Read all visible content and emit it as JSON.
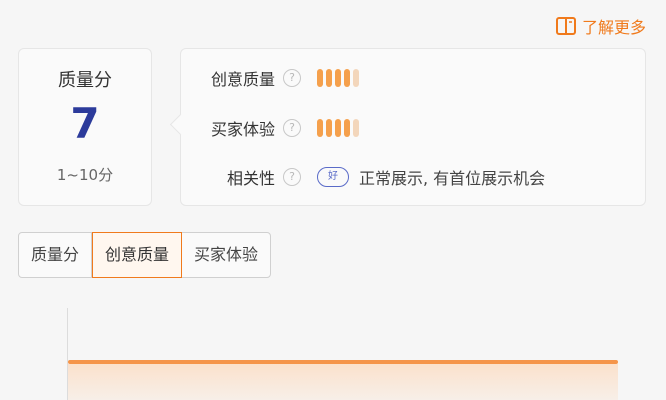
{
  "header": {
    "learn_more": "了解更多",
    "icon": "book-icon"
  },
  "score_card": {
    "title": "质量分",
    "score": "7",
    "range": "1~10分"
  },
  "details": {
    "rows": [
      {
        "label": "创意质量",
        "help": "?",
        "level_bars_filled": 4,
        "level_bars_total": 5
      },
      {
        "label": "买家体验",
        "help": "?",
        "level_bars_filled": 4,
        "level_bars_total": 5
      },
      {
        "label": "相关性",
        "help": "?",
        "badge": "好",
        "note": "正常展示, 有首位展示机会"
      }
    ]
  },
  "tabs": [
    {
      "label": "质量分",
      "active": false
    },
    {
      "label": "创意质量",
      "active": true
    },
    {
      "label": "买家体验",
      "active": false
    }
  ],
  "colors": {
    "accent": "#f07a1c",
    "score": "#2c3b9b",
    "bar_on": "#f5a04c",
    "bar_off": "#f3d6bb"
  }
}
